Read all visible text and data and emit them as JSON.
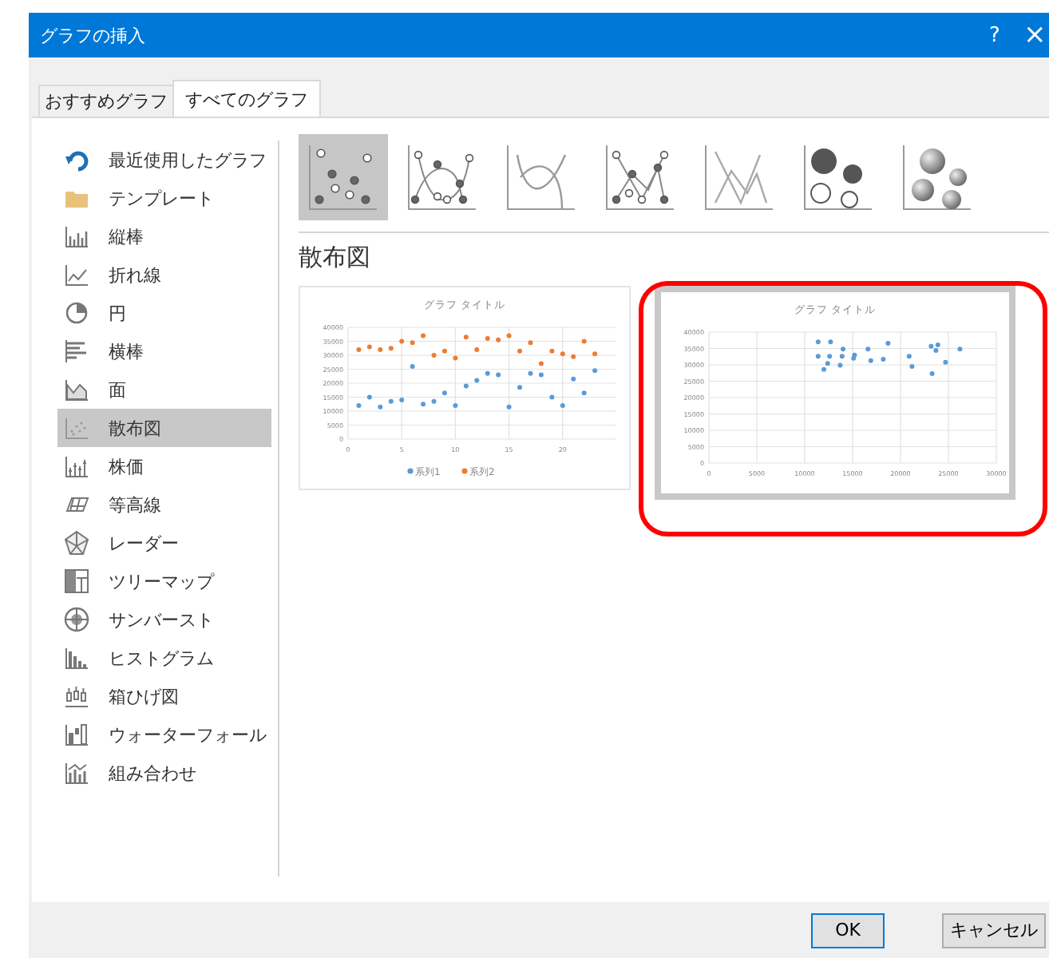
{
  "window": {
    "title": "グラフの挿入",
    "help": "?",
    "close": "×"
  },
  "tabs": [
    {
      "label": "おすすめグラフ",
      "selected": false
    },
    {
      "label": "すべてのグラフ",
      "selected": true
    }
  ],
  "sidebar": {
    "items": [
      {
        "label": "最近使用したグラフ",
        "selected": false
      },
      {
        "label": "テンプレート",
        "selected": false
      },
      {
        "label": "縦棒",
        "selected": false
      },
      {
        "label": "折れ線",
        "selected": false
      },
      {
        "label": "円",
        "selected": false
      },
      {
        "label": "横棒",
        "selected": false
      },
      {
        "label": "面",
        "selected": false
      },
      {
        "label": "散布図",
        "selected": true
      },
      {
        "label": "株価",
        "selected": false
      },
      {
        "label": "等高線",
        "selected": false
      },
      {
        "label": "レーダー",
        "selected": false
      },
      {
        "label": "ツリーマップ",
        "selected": false
      },
      {
        "label": "サンバースト",
        "selected": false
      },
      {
        "label": "ヒストグラム",
        "selected": false
      },
      {
        "label": "箱ひげ図",
        "selected": false
      },
      {
        "label": "ウォーターフォール",
        "selected": false
      },
      {
        "label": "組み合わせ",
        "selected": false
      }
    ]
  },
  "subtypes": [
    {
      "selected": true
    },
    {
      "selected": false
    },
    {
      "selected": false
    },
    {
      "selected": false
    },
    {
      "selected": false
    },
    {
      "selected": false
    },
    {
      "selected": false
    }
  ],
  "section_title": "散布図",
  "previews": [
    {
      "selected": false,
      "chart_data": {
        "type": "scatter",
        "title": "グラフ タイトル",
        "xlim": [
          0,
          25
        ],
        "ylim": [
          0,
          40000
        ],
        "xticks": [
          0,
          5,
          10,
          15,
          20
        ],
        "grid": true,
        "legend": "bottom",
        "yticks": [
          0,
          5000,
          10000,
          15000,
          20000,
          25000,
          30000,
          35000,
          40000
        ],
        "x": [
          1,
          2,
          3,
          4,
          5,
          6,
          7,
          8,
          9,
          10,
          11,
          12,
          13,
          14,
          15,
          16,
          17,
          18,
          19,
          20,
          21,
          22,
          23
        ],
        "series": [
          {
            "name": "系列1",
            "color": "#5b9bd5",
            "values": [
              12000,
              15000,
              11500,
              13500,
              14000,
              26000,
              12500,
              13500,
              16500,
              12000,
              19000,
              21000,
              23500,
              23000,
              11500,
              18500,
              23500,
              23000,
              15000,
              12000,
              21500,
              16500,
              24500
            ]
          },
          {
            "name": "系列2",
            "color": "#ed7d31",
            "values": [
              32000,
              33000,
              32000,
              32500,
              35000,
              34500,
              37000,
              30000,
              31500,
              29000,
              36500,
              32000,
              36000,
              35500,
              37000,
              31500,
              34500,
              27000,
              31500,
              30500,
              29500,
              35000,
              30500
            ]
          }
        ]
      }
    },
    {
      "selected": true,
      "chart_data": {
        "type": "scatter",
        "title": "グラフ タイトル",
        "xlim": [
          0,
          30000
        ],
        "ylim": [
          0,
          40000
        ],
        "xticks": [
          0,
          5000,
          10000,
          15000,
          20000,
          25000,
          30000
        ],
        "grid": true,
        "yticks": [
          0,
          5000,
          10000,
          15000,
          20000,
          25000,
          30000,
          35000,
          40000
        ],
        "x": [
          11400,
          12700,
          14000,
          11400,
          12600,
          13900,
          12400,
          12000,
          13700,
          15200,
          15100,
          16600,
          16900,
          18200,
          18700,
          20900,
          21200,
          23200,
          23900,
          23700,
          23300,
          24700,
          26200
        ],
        "series": [
          {
            "color": "#5b9bd5",
            "values": [
              37000,
              37000,
              34800,
              32600,
              32600,
              32600,
              30400,
              28600,
              29900,
              33000,
              32000,
              34800,
              31300,
              31700,
              36600,
              32600,
              29500,
              35700,
              36100,
              34400,
              27300,
              30800,
              34800
            ]
          }
        ]
      }
    }
  ],
  "buttons": [
    {
      "label": "OK",
      "kind": "default"
    },
    {
      "label": "キャンセル",
      "kind": "normal"
    }
  ]
}
